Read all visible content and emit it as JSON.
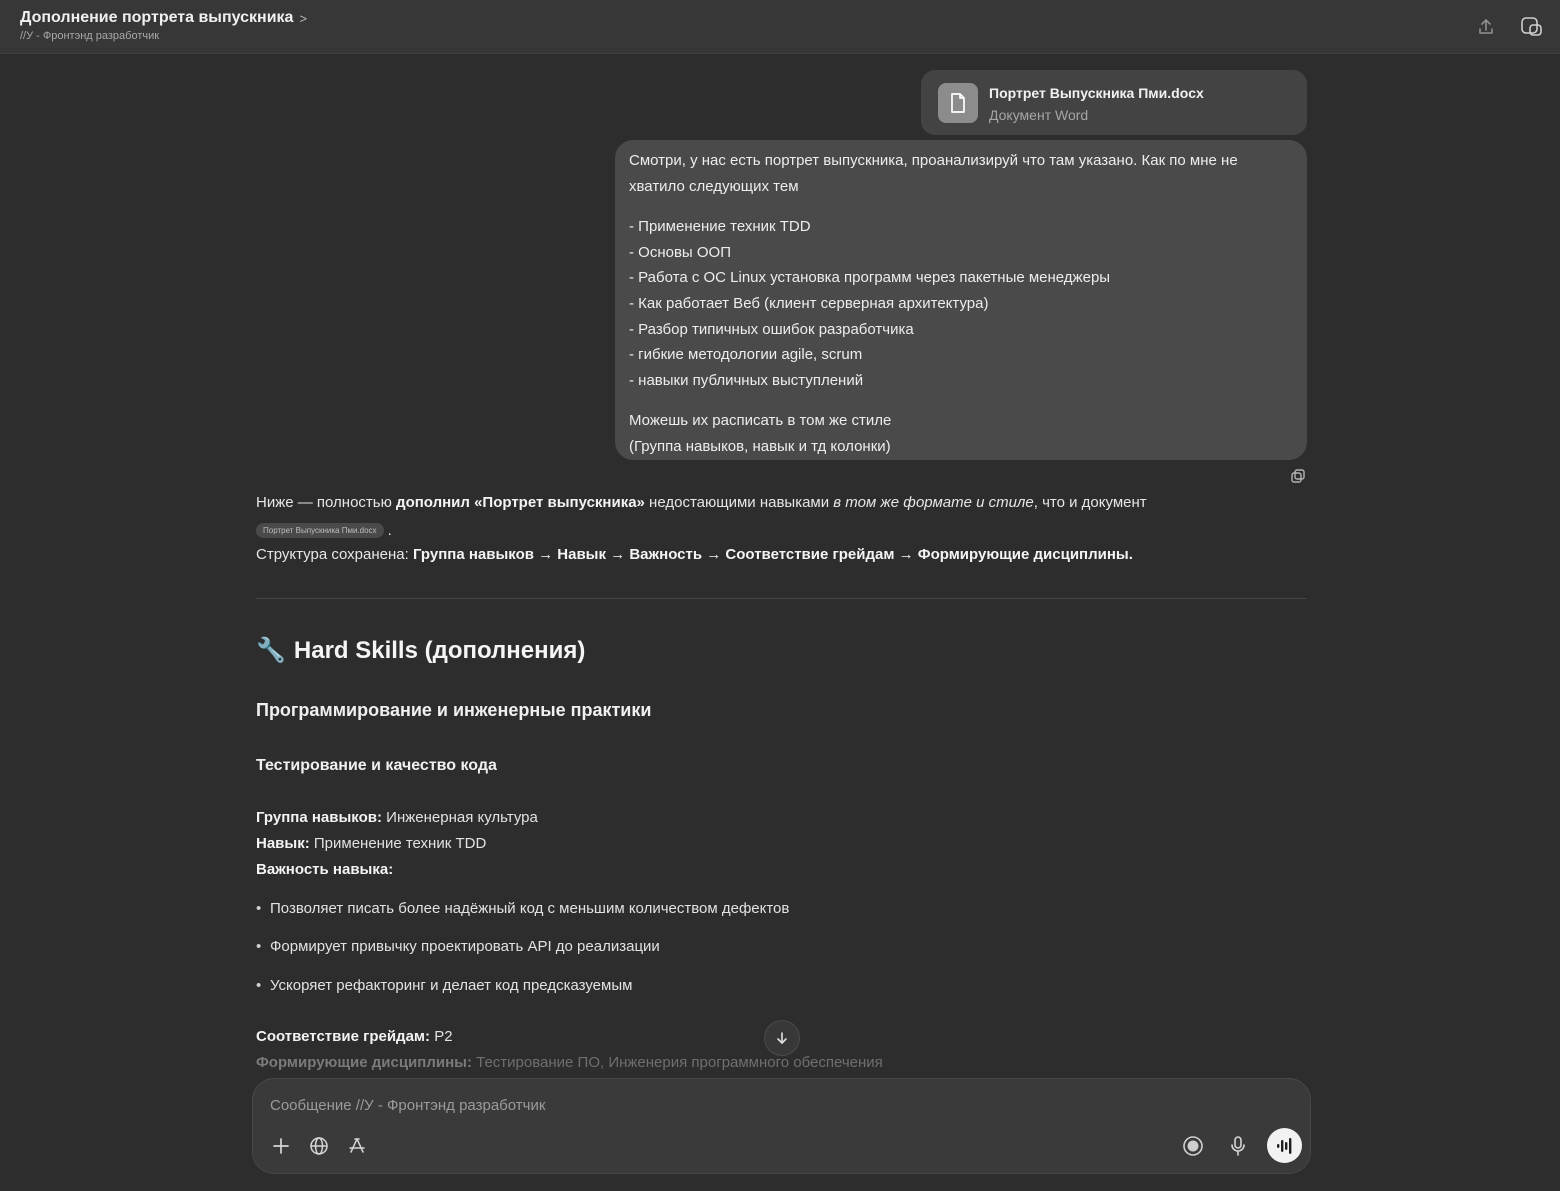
{
  "header": {
    "title": "Дополнение портрета выпускника",
    "title_chevron": ">",
    "subtitle": "//У - Фронтэнд разработчик"
  },
  "attachment": {
    "name": "Портрет Выпускника Пми.docx",
    "type": "Документ Word"
  },
  "user_message": {
    "intro_line1": "Смотри, у нас есть портрет выпускника, проанализируй что там указано. Как по мне не",
    "intro_line2": "хватило следующих тем",
    "items": [
      "- Применение техник TDD",
      "- Основы ООП",
      "- Работа с ОС Linux установка программ через пакетные менеджеры",
      "- Как работает Веб (клиент серверная архитектура)",
      "- Разбор типичных ошибок разработчика",
      "- гибкие методологии agile, scrum",
      "- навыки публичных выступлений"
    ],
    "outro_line1": "Можешь их расписать в том же стиле",
    "outro_line2": "(Группа навыков, навык и тд колонки)"
  },
  "assistant": {
    "intro_a": "Ниже — полностью ",
    "intro_b": "дополнил «Портрет выпускника»",
    "intro_c": " недостающими навыками ",
    "intro_d": "в том же формате и стиле",
    "intro_e": ", что и документ",
    "chip": "Портрет Выпускника Пми.docx",
    "period": ".",
    "structure_label": "Структура сохранена: ",
    "structure_value": "Группа навыков → Навык → Важность → Соответствие грейдам → Формирующие дисциплины.",
    "h1_icon": "🔧",
    "h1": "Hard Skills (дополнения)",
    "h2": "Программирование и инженерные практики",
    "h3": "Тестирование и качество кода",
    "group_label": "Группа навыков:",
    "group_value": " Инженерная культура",
    "skill_label": "Навык:",
    "skill_value": " Применение техник TDD",
    "importance_label": "Важность навыка:",
    "bullets": [
      "Позволяет писать более надёжный код с меньшим количеством дефектов",
      "Формирует привычку проектировать API до реализации",
      "Ускоряет рефакторинг и делает код предсказуемым"
    ],
    "grade_label": "Соответствие грейдам:",
    "grade_value": " P2",
    "disciplines_label": "Формирующие дисциплины:",
    "disciplines_value": " Тестирование ПО, Инженерия программного обеспечения"
  },
  "composer": {
    "placeholder": "Сообщение //У - Фронтэнд разработчик"
  },
  "icons": {
    "share": "share-icon",
    "new_chat": "new-chat-icon",
    "file": "document-icon",
    "copy": "copy-icon",
    "scroll": "arrow-down-icon",
    "plus": "plus-icon",
    "globe": "globe-icon",
    "tools": "tools-icon",
    "record": "record-icon",
    "mic": "microphone-icon",
    "voice": "voice-mode-icon"
  }
}
